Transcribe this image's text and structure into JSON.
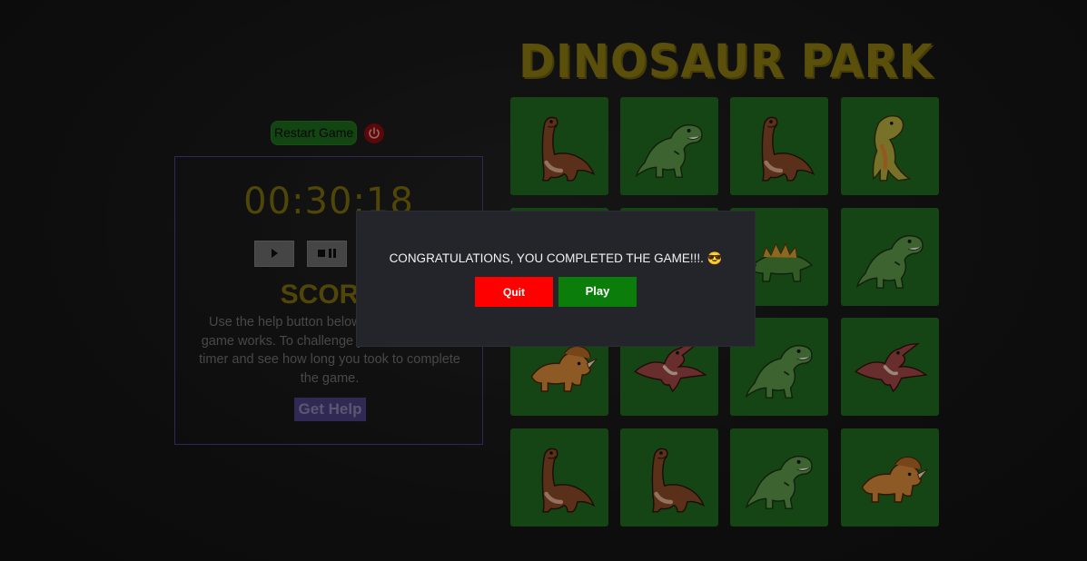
{
  "header": {
    "title": "DINOSAUR PARK"
  },
  "controls": {
    "restart_label": "Restart Game",
    "restart_icon": "power-icon"
  },
  "panel": {
    "timer": "00:30:18",
    "score_label": "SCORE",
    "help_text": "Use the help button below to see how the game works. To challenge yourself, start the timer and see how long you took to complete the game.",
    "help_button": "Get Help",
    "buttons": [
      {
        "name": "play",
        "icon": "play-icon"
      },
      {
        "name": "stop-pause",
        "icon": "stop-pause-icon"
      },
      {
        "name": "reset",
        "icon": "reset-icon"
      }
    ]
  },
  "grid": {
    "cards": [
      {
        "dino": "brown-longneck"
      },
      {
        "dino": "green-trex"
      },
      {
        "dino": "brown-longneck"
      },
      {
        "dino": "green-yellow-trex"
      },
      {
        "dino": "hidden"
      },
      {
        "dino": "hidden"
      },
      {
        "dino": "green-stegosaurus"
      },
      {
        "dino": "green-trex"
      },
      {
        "dino": "orange-triceratops"
      },
      {
        "dino": "red-pterodactyl"
      },
      {
        "dino": "green-trex"
      },
      {
        "dino": "red-pterodactyl"
      },
      {
        "dino": "brown-longneck"
      },
      {
        "dino": "brown-longneck"
      },
      {
        "dino": "green-trex-roaring"
      },
      {
        "dino": "orange-triceratops"
      }
    ]
  },
  "modal": {
    "message": "CONGRATULATIONS, YOU COMPLETED THE GAME!!!. 😎",
    "quit_label": "Quit",
    "play_label": "Play"
  },
  "colors": {
    "card_bg": "#216b21",
    "title_gold": "#8a7a12",
    "quit_red": "#ff0000",
    "play_green": "#0b7d0b"
  }
}
